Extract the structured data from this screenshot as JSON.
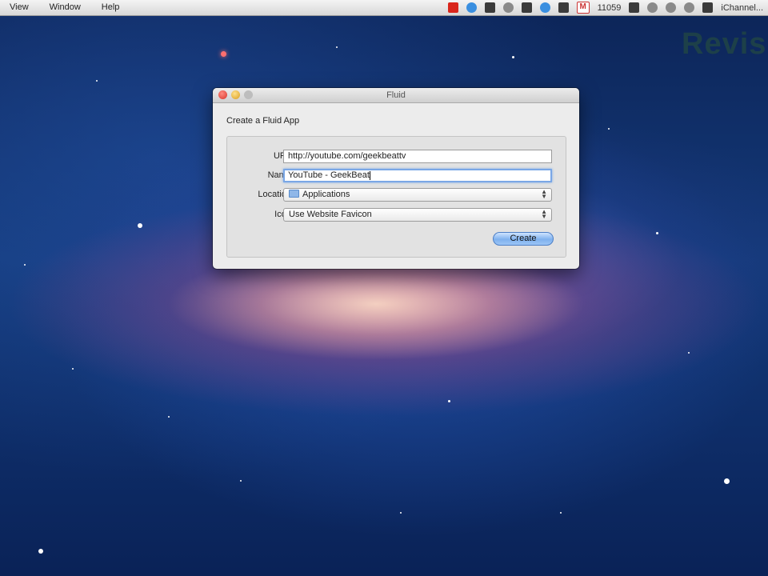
{
  "menubar": {
    "items": [
      "View",
      "Window",
      "Help"
    ],
    "status_count": "11059",
    "status_user": "iChannel..."
  },
  "watermark": "Revis",
  "window": {
    "title": "Fluid",
    "heading": "Create a Fluid App",
    "url_label": "URL:",
    "url_value": "http://youtube.com/geekbeattv",
    "name_label": "Name:",
    "name_value": "YouTube - GeekBeat",
    "location_label": "Location:",
    "location_value": "Applications",
    "icon_label": "Icon:",
    "icon_value": "Use Website Favicon",
    "create_label": "Create"
  },
  "colors": {
    "accent": "#7fb1ee",
    "close": "#d8362b",
    "minimize": "#d99d1d"
  }
}
